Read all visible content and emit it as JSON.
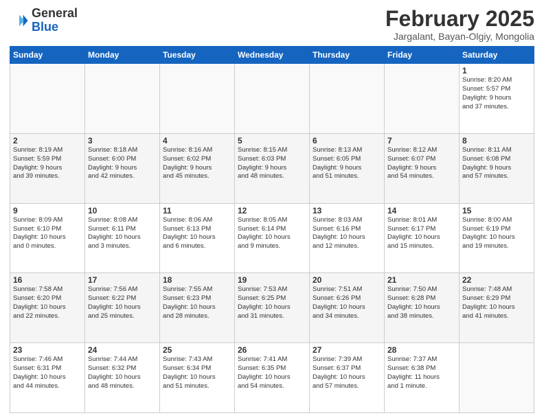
{
  "logo": {
    "general": "General",
    "blue": "Blue"
  },
  "header": {
    "month": "February 2025",
    "location": "Jargalant, Bayan-Olgiy, Mongolia"
  },
  "weekdays": [
    "Sunday",
    "Monday",
    "Tuesday",
    "Wednesday",
    "Thursday",
    "Friday",
    "Saturday"
  ],
  "weeks": [
    [
      {
        "day": "",
        "info": ""
      },
      {
        "day": "",
        "info": ""
      },
      {
        "day": "",
        "info": ""
      },
      {
        "day": "",
        "info": ""
      },
      {
        "day": "",
        "info": ""
      },
      {
        "day": "",
        "info": ""
      },
      {
        "day": "1",
        "info": "Sunrise: 8:20 AM\nSunset: 5:57 PM\nDaylight: 9 hours\nand 37 minutes."
      }
    ],
    [
      {
        "day": "2",
        "info": "Sunrise: 8:19 AM\nSunset: 5:59 PM\nDaylight: 9 hours\nand 39 minutes."
      },
      {
        "day": "3",
        "info": "Sunrise: 8:18 AM\nSunset: 6:00 PM\nDaylight: 9 hours\nand 42 minutes."
      },
      {
        "day": "4",
        "info": "Sunrise: 8:16 AM\nSunset: 6:02 PM\nDaylight: 9 hours\nand 45 minutes."
      },
      {
        "day": "5",
        "info": "Sunrise: 8:15 AM\nSunset: 6:03 PM\nDaylight: 9 hours\nand 48 minutes."
      },
      {
        "day": "6",
        "info": "Sunrise: 8:13 AM\nSunset: 6:05 PM\nDaylight: 9 hours\nand 51 minutes."
      },
      {
        "day": "7",
        "info": "Sunrise: 8:12 AM\nSunset: 6:07 PM\nDaylight: 9 hours\nand 54 minutes."
      },
      {
        "day": "8",
        "info": "Sunrise: 8:11 AM\nSunset: 6:08 PM\nDaylight: 9 hours\nand 57 minutes."
      }
    ],
    [
      {
        "day": "9",
        "info": "Sunrise: 8:09 AM\nSunset: 6:10 PM\nDaylight: 10 hours\nand 0 minutes."
      },
      {
        "day": "10",
        "info": "Sunrise: 8:08 AM\nSunset: 6:11 PM\nDaylight: 10 hours\nand 3 minutes."
      },
      {
        "day": "11",
        "info": "Sunrise: 8:06 AM\nSunset: 6:13 PM\nDaylight: 10 hours\nand 6 minutes."
      },
      {
        "day": "12",
        "info": "Sunrise: 8:05 AM\nSunset: 6:14 PM\nDaylight: 10 hours\nand 9 minutes."
      },
      {
        "day": "13",
        "info": "Sunrise: 8:03 AM\nSunset: 6:16 PM\nDaylight: 10 hours\nand 12 minutes."
      },
      {
        "day": "14",
        "info": "Sunrise: 8:01 AM\nSunset: 6:17 PM\nDaylight: 10 hours\nand 15 minutes."
      },
      {
        "day": "15",
        "info": "Sunrise: 8:00 AM\nSunset: 6:19 PM\nDaylight: 10 hours\nand 19 minutes."
      }
    ],
    [
      {
        "day": "16",
        "info": "Sunrise: 7:58 AM\nSunset: 6:20 PM\nDaylight: 10 hours\nand 22 minutes."
      },
      {
        "day": "17",
        "info": "Sunrise: 7:56 AM\nSunset: 6:22 PM\nDaylight: 10 hours\nand 25 minutes."
      },
      {
        "day": "18",
        "info": "Sunrise: 7:55 AM\nSunset: 6:23 PM\nDaylight: 10 hours\nand 28 minutes."
      },
      {
        "day": "19",
        "info": "Sunrise: 7:53 AM\nSunset: 6:25 PM\nDaylight: 10 hours\nand 31 minutes."
      },
      {
        "day": "20",
        "info": "Sunrise: 7:51 AM\nSunset: 6:26 PM\nDaylight: 10 hours\nand 34 minutes."
      },
      {
        "day": "21",
        "info": "Sunrise: 7:50 AM\nSunset: 6:28 PM\nDaylight: 10 hours\nand 38 minutes."
      },
      {
        "day": "22",
        "info": "Sunrise: 7:48 AM\nSunset: 6:29 PM\nDaylight: 10 hours\nand 41 minutes."
      }
    ],
    [
      {
        "day": "23",
        "info": "Sunrise: 7:46 AM\nSunset: 6:31 PM\nDaylight: 10 hours\nand 44 minutes."
      },
      {
        "day": "24",
        "info": "Sunrise: 7:44 AM\nSunset: 6:32 PM\nDaylight: 10 hours\nand 48 minutes."
      },
      {
        "day": "25",
        "info": "Sunrise: 7:43 AM\nSunset: 6:34 PM\nDaylight: 10 hours\nand 51 minutes."
      },
      {
        "day": "26",
        "info": "Sunrise: 7:41 AM\nSunset: 6:35 PM\nDaylight: 10 hours\nand 54 minutes."
      },
      {
        "day": "27",
        "info": "Sunrise: 7:39 AM\nSunset: 6:37 PM\nDaylight: 10 hours\nand 57 minutes."
      },
      {
        "day": "28",
        "info": "Sunrise: 7:37 AM\nSunset: 6:38 PM\nDaylight: 11 hours\nand 1 minute."
      },
      {
        "day": "",
        "info": ""
      }
    ]
  ]
}
